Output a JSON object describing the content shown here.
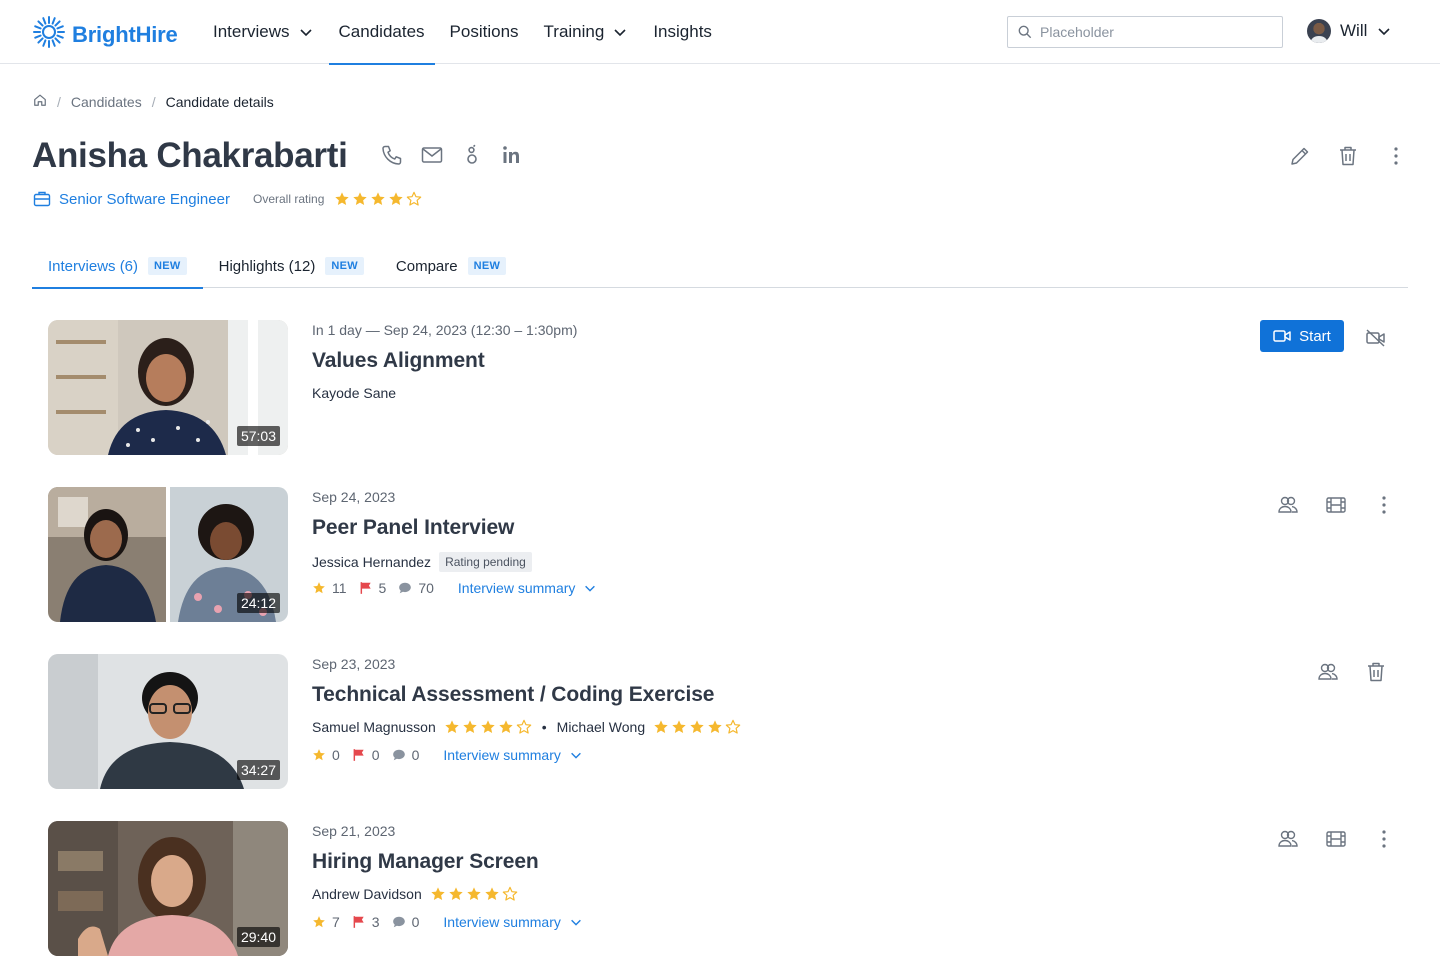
{
  "brand": {
    "name": "BrightHire",
    "color": "#1f7fe0",
    "icon": "sunburst-logo-icon"
  },
  "nav": {
    "items": [
      {
        "label": "Interviews",
        "dropdown": true,
        "active": false
      },
      {
        "label": "Candidates",
        "dropdown": false,
        "active": true
      },
      {
        "label": "Positions",
        "dropdown": false,
        "active": false
      },
      {
        "label": "Training",
        "dropdown": true,
        "active": false
      },
      {
        "label": "Insights",
        "dropdown": false,
        "active": false
      }
    ],
    "search_placeholder": "Placeholder",
    "user": {
      "name": "Will"
    }
  },
  "breadcrumb": {
    "items": [
      "Candidates",
      "Candidate details"
    ]
  },
  "candidate": {
    "name": "Anisha Chakrabarti",
    "position": "Senior Software Engineer",
    "rating_label": "Overall rating",
    "rating": 4,
    "rating_max": 5
  },
  "tabs": [
    {
      "label": "Interviews (6)",
      "badge": "NEW",
      "active": true
    },
    {
      "label": "Highlights (12)",
      "badge": "NEW",
      "active": false
    },
    {
      "label": "Compare",
      "badge": "NEW",
      "active": false
    }
  ],
  "interviews": [
    {
      "date": "In 1 day — Sep 24, 2023 (12:30 – 1:30pm)",
      "title": "Values Alignment",
      "duration": "57:03",
      "interviewers": [
        {
          "name": "Kayode Sane"
        }
      ],
      "start_label": "Start"
    },
    {
      "date": "Sep 24, 2023",
      "title": "Peer Panel Interview",
      "duration": "24:12",
      "interviewers": [
        {
          "name": "Jessica Hernandez"
        }
      ],
      "pending_label": "Rating pending",
      "stats": {
        "stars": "11",
        "flags": "5",
        "comments": "70"
      },
      "summary_label": "Interview summary"
    },
    {
      "date": "Sep 23, 2023",
      "title": "Technical Assessment / Coding Exercise",
      "duration": "34:27",
      "interviewers": [
        {
          "name": "Samuel Magnusson",
          "rating": 4
        },
        {
          "name": "Michael Wong",
          "rating": 4
        }
      ],
      "stats": {
        "stars": "0",
        "flags": "0",
        "comments": "0"
      },
      "summary_label": "Interview summary"
    },
    {
      "date": "Sep 21, 2023",
      "title": "Hiring Manager Screen",
      "duration": "29:40",
      "interviewers": [
        {
          "name": "Andrew Davidson",
          "rating": 4
        }
      ],
      "stats": {
        "stars": "7",
        "flags": "3",
        "comments": "0"
      },
      "summary_label": "Interview summary"
    }
  ],
  "colors": {
    "accent": "#1f7fe0",
    "star": "#f5b82e",
    "flag": "#e5484d",
    "button": "#1072d8"
  }
}
